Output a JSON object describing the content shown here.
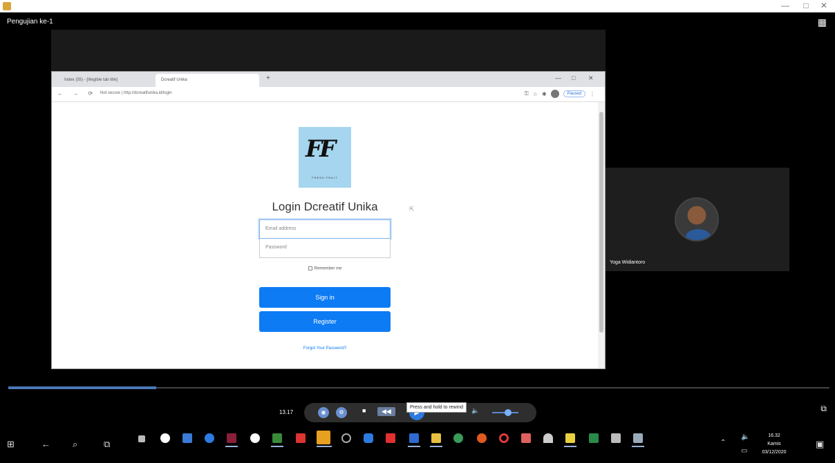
{
  "window": {
    "minimize": "—",
    "maximize": "□",
    "close": "✕"
  },
  "meeting": {
    "title": "Pengujian ke-1",
    "layout_icon": "grid-icon"
  },
  "browser": {
    "tab_inactive": "Index (55) - [Illegible tab title]",
    "tab_active": "Dcreatif Unika",
    "new_tab": "+",
    "window_controls": [
      "—",
      "□",
      "✕"
    ],
    "nav": "← → ⟳",
    "url": "Not secure | http://dcreatifunika.id/login",
    "paused": "Paused"
  },
  "login": {
    "logo_mark": "FF",
    "logo_sub": "FRESH FRUIT",
    "title": "Login Dcreatif Unika",
    "email_placeholder": "Email address",
    "password_placeholder": "Password",
    "remember": "Remember me",
    "signin": "Sign in",
    "register": "Register",
    "forgot": "Forgot Your Password?"
  },
  "participant": {
    "name": "Yoga Widiantoro"
  },
  "player": {
    "time": "13.17",
    "tooltip": "Press and hold to rewind",
    "progress_fraction": 0.18,
    "volume_fraction": 0.6
  },
  "taskbar": {
    "clock_time": "16.32",
    "clock_day": "Kamis",
    "clock_date": "03/12/2020"
  },
  "colors": {
    "primary_button": "#0d7bf4",
    "logo_bg": "#a6d5ef",
    "progress": "#4a78b8"
  }
}
